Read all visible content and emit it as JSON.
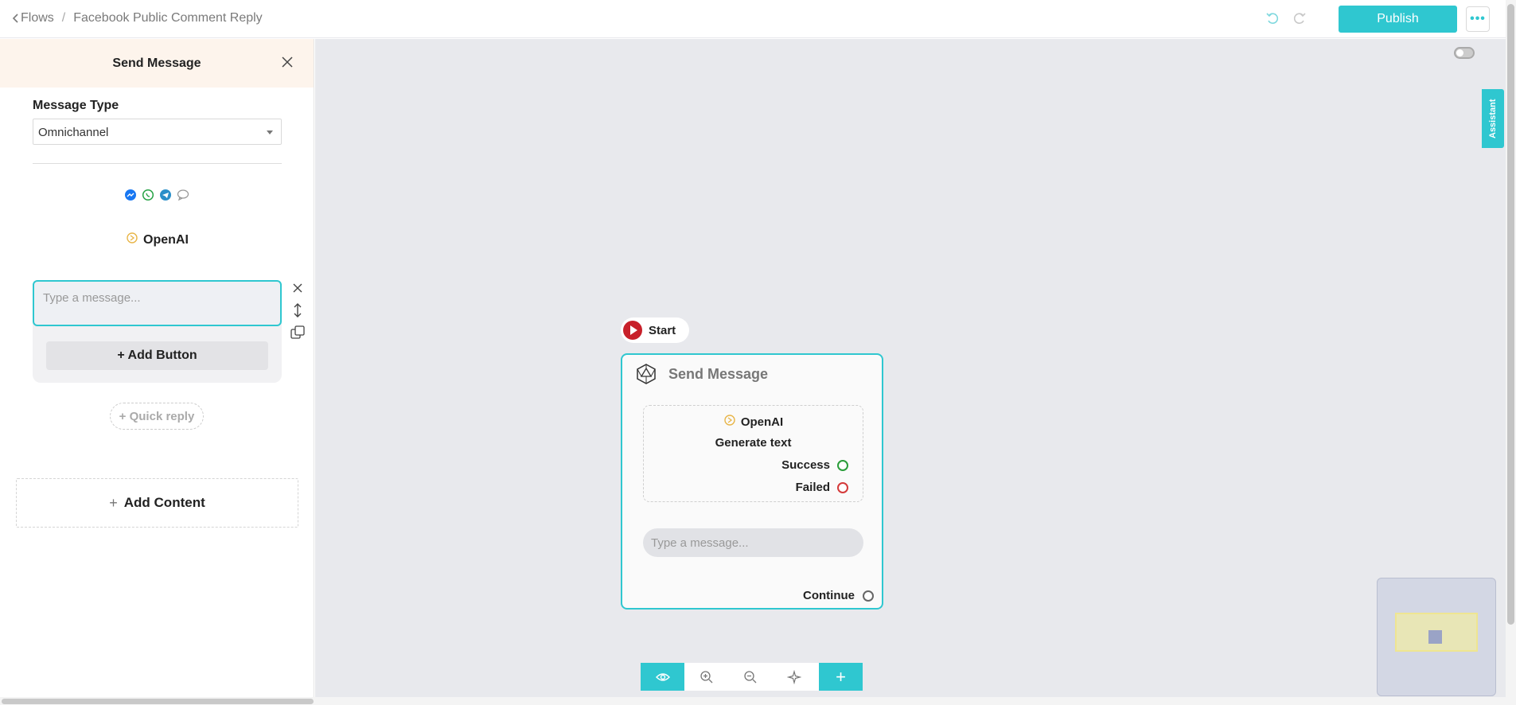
{
  "header": {
    "breadcrumb_root": "Flows",
    "breadcrumb_sep": "/",
    "breadcrumb_current": "Facebook Public Comment Reply",
    "publish_label": "Publish",
    "more_label": "•••"
  },
  "panel": {
    "title": "Send Message",
    "message_type_label": "Message Type",
    "message_type_value": "Omnichannel",
    "channel_icons": [
      "messenger-icon",
      "whatsapp-icon",
      "telegram-icon",
      "chat-icon"
    ],
    "provider": "OpenAI",
    "message_placeholder": "Type a message...",
    "add_button_label": "+ Add Button",
    "quick_reply_label": "+ Quick reply",
    "add_content_plus": "+",
    "add_content_label": "Add Content"
  },
  "canvas": {
    "assistant_tab": "Assistant",
    "start_label": "Start",
    "node": {
      "title": "Send Message",
      "provider": "OpenAI",
      "action": "Generate text",
      "success_label": "Success",
      "failed_label": "Failed",
      "message_placeholder": "Type a message...",
      "continue_label": "Continue"
    },
    "toolbar_plus": "+"
  },
  "colors": {
    "accent": "#2fc7d0",
    "success": "#2a9d3a",
    "failed": "#d43a3a",
    "start": "#c8202a"
  }
}
